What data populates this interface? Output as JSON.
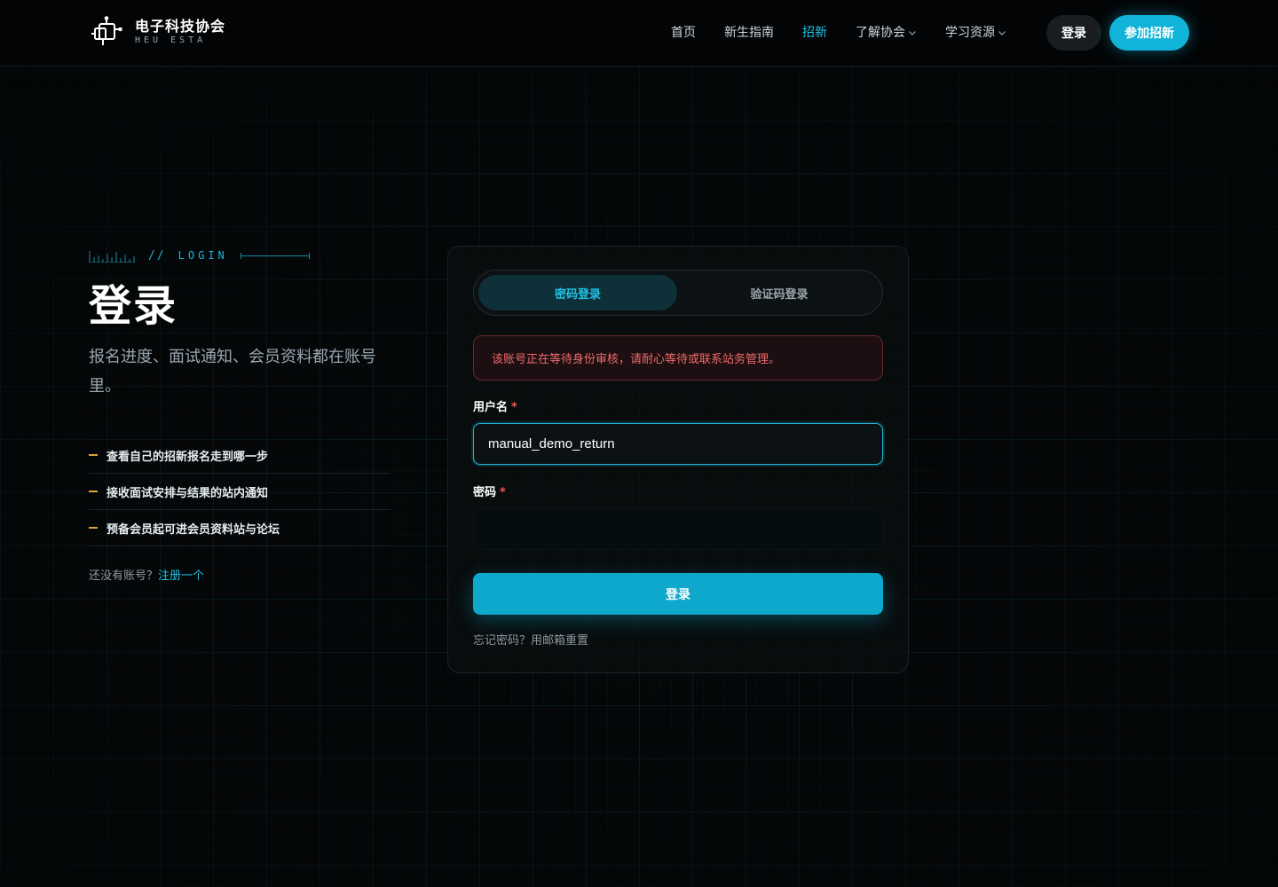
{
  "brand": {
    "name": "电子科技协会",
    "sub": "HEU ESTA"
  },
  "nav": {
    "items": [
      {
        "label": "首页"
      },
      {
        "label": "新生指南"
      },
      {
        "label": "招新",
        "active": true
      },
      {
        "label": "了解协会",
        "dropdown": true
      },
      {
        "label": "学习资源",
        "dropdown": true
      }
    ],
    "login_label": "登录",
    "join_label": "参加招新"
  },
  "intro": {
    "eyebrow_slash": "//",
    "eyebrow_text": "LOGIN",
    "title": "登录",
    "description": "报名进度、面试通知、会员资料都在账号里。",
    "features": [
      "查看自己的招新报名走到哪一步",
      "接收面试安排与结果的站内通知",
      "预备会员起可进会员资料站与论坛"
    ],
    "register_prompt": "还没有账号？",
    "register_link": "注册一个"
  },
  "form": {
    "tabs": [
      {
        "label": "密码登录",
        "active": true
      },
      {
        "label": "验证码登录",
        "active": false
      }
    ],
    "alert": "该账号正在等待身份审核，请耐心等待或联系站务管理。",
    "username_label": "用户名",
    "username_value": "manual_demo_return",
    "password_label": "密码",
    "password_value": "",
    "required_mark": "*",
    "submit_label": "登录",
    "forgot_label": "忘记密码？用邮箱重置"
  },
  "colors": {
    "accent": "#22c3e6",
    "button": "#0ea8cc",
    "error": "#ef6b6b",
    "dash": "#e0a335"
  }
}
